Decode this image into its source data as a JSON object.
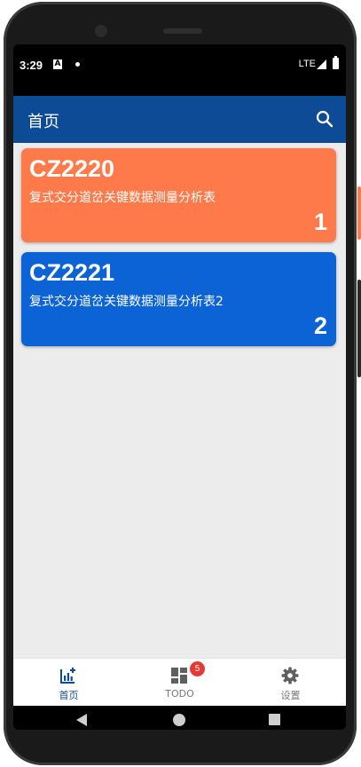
{
  "status_bar": {
    "time": "3:29",
    "notification_glyph": "A",
    "network": "LTE"
  },
  "app_bar": {
    "title": "首页",
    "search_icon": "search-icon"
  },
  "cards": [
    {
      "code": "CZ2220",
      "description": "复式交分道岔关键数据测量分析表",
      "number": "1",
      "color": "#ff7a4a"
    },
    {
      "code": "CZ2221",
      "description": "复式交分道岔关键数据测量分析表2",
      "number": "2",
      "color": "#0b63d6"
    }
  ],
  "bottom_nav": {
    "items": [
      {
        "label": "首页",
        "icon": "chart-add-icon",
        "active": true,
        "color": "#0d4b96"
      },
      {
        "label": "TODO",
        "icon": "dashboard-icon",
        "badge": "5",
        "color": "#777777"
      },
      {
        "label": "设置",
        "icon": "gear-icon",
        "color": "#777777"
      }
    ]
  }
}
